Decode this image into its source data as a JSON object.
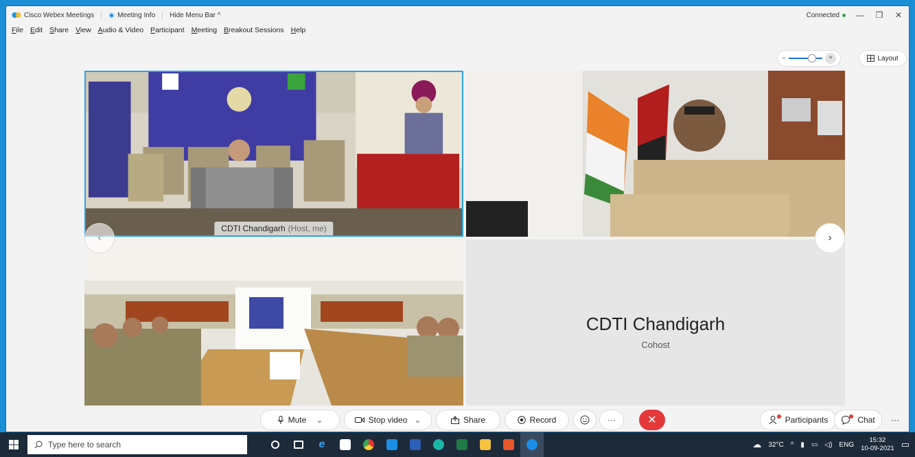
{
  "title_bar": {
    "app_title": "Cisco Webex Meetings",
    "meeting_info": "Meeting Info",
    "hide_menu_bar": "Hide Menu Bar ^",
    "status": "Connected",
    "minimize": "—",
    "restore": "❐",
    "close": "✕"
  },
  "menu": {
    "items": [
      "File",
      "Edit",
      "Share",
      "View",
      "Audio & Video",
      "Participant",
      "Meeting",
      "Breakout Sessions",
      "Help"
    ]
  },
  "view_controls": {
    "zoom_out": "−",
    "zoom_in": "+",
    "zoom_level": 0.5,
    "layout_label": "Layout"
  },
  "videos": {
    "tile_1": {
      "name": "CDTI Chandigarh",
      "role": "(Host, me)"
    },
    "tile_4": {
      "name": "CDTI Chandigarh",
      "role": "Cohost"
    }
  },
  "toolbar": {
    "mute": "Mute",
    "stop_video": "Stop video",
    "share": "Share",
    "record": "Record",
    "more": "···",
    "leave": "✕",
    "participants": "Participants",
    "chat": "Chat",
    "more_right": "···"
  },
  "taskbar": {
    "search_placeholder": "Type here to search",
    "weather": "32°C",
    "language": "ENG",
    "time": "15:32",
    "date": "10-09-2021"
  },
  "colors": {
    "accent": "#1b8ee6",
    "leave_red": "#e5383b",
    "taskbar_bg": "#1d2a3a"
  }
}
